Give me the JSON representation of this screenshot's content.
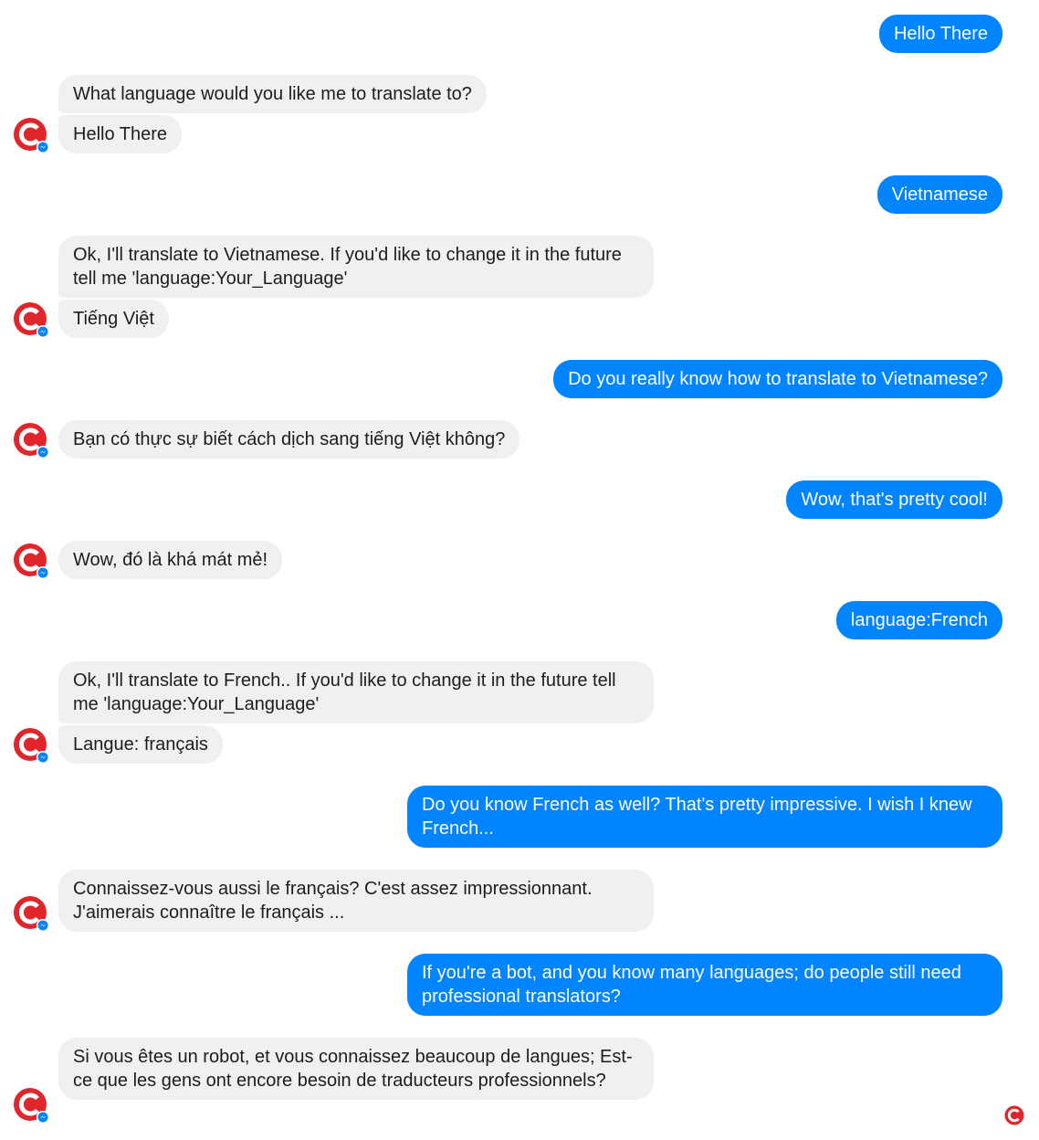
{
  "colors": {
    "outgoing_bubble": "#0084ff",
    "incoming_bubble": "#f1f0f0",
    "avatar_red": "#e0252b",
    "messenger_badge": "#0084ff"
  },
  "bot": {
    "avatar_icon": "bot-logo-icon"
  },
  "messages": [
    {
      "from": "user",
      "text": "Hello There"
    },
    {
      "from": "bot",
      "text": "What language would you like me to translate to?"
    },
    {
      "from": "bot",
      "text": "Hello There"
    },
    {
      "from": "user",
      "text": "Vietnamese"
    },
    {
      "from": "bot",
      "text": "Ok, I'll translate to Vietnamese. If you'd like to change it in the future tell me 'language:Your_Language'"
    },
    {
      "from": "bot",
      "text": "Tiếng Việt"
    },
    {
      "from": "user",
      "text": "Do you really know how to translate to Vietnamese?"
    },
    {
      "from": "bot",
      "text": "Bạn có thực sự biết cách dịch sang tiếng Việt không?"
    },
    {
      "from": "user",
      "text": "Wow, that's pretty cool!"
    },
    {
      "from": "bot",
      "text": "Wow, đó là khá mát mẻ!"
    },
    {
      "from": "user",
      "text": "language:French"
    },
    {
      "from": "bot",
      "text": "Ok, I'll translate to French.. If you'd like to change it in the future tell me 'language:Your_Language'"
    },
    {
      "from": "bot",
      "text": "Langue: français"
    },
    {
      "from": "user",
      "text": "Do you know French as well? That's pretty impressive. I wish I knew French..."
    },
    {
      "from": "bot",
      "text": "Connaissez-vous aussi le français? C'est assez impressionnant. J'aimerais connaître le français ..."
    },
    {
      "from": "user",
      "text": "If you're a bot, and you know many languages; do people still need professional translators?"
    },
    {
      "from": "bot",
      "text": "Si vous êtes un robot, et vous connaissez beaucoup de langues; Est-ce que les gens ont encore besoin de traducteurs professionnels?"
    }
  ]
}
